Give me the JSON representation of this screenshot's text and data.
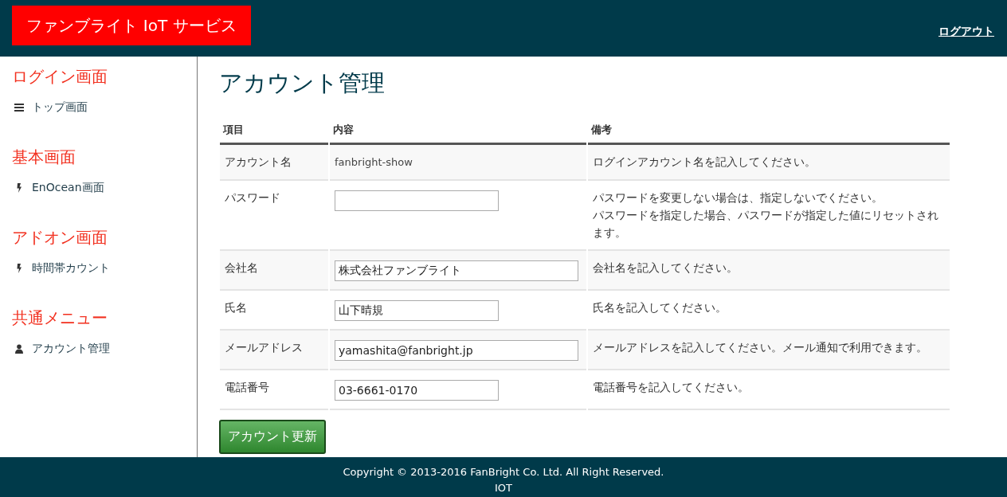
{
  "header": {
    "brand": "ファンブライト IoT サービス",
    "logout": "ログアウト"
  },
  "sidebar": [
    {
      "heading": "ログイン画面",
      "items": [
        {
          "label": "トップ画面",
          "kind": "list"
        }
      ]
    },
    {
      "heading": "基本画面",
      "items": [
        {
          "label": "EnOcean画面",
          "kind": "bolt"
        }
      ]
    },
    {
      "heading": "アドオン画面",
      "items": [
        {
          "label": "時間帯カウント",
          "kind": "bolt"
        }
      ]
    },
    {
      "heading": "共通メニュー",
      "items": [
        {
          "label": "アカウント管理",
          "kind": "user"
        }
      ]
    }
  ],
  "page_title": "アカウント管理",
  "table": {
    "columns": [
      "項目",
      "内容",
      "備考"
    ],
    "rows": [
      {
        "label": "アカウント名",
        "kind": "text",
        "value": "fanbright-show",
        "remarks": [
          "ログインアカウント名を記入してください。"
        ]
      },
      {
        "label": "パスワード",
        "kind": "short_field",
        "remarks": [
          "パスワードを変更しない場合は、指定しないでください。",
          "パスワードを指定した場合、パスワードが指定した値にリセットされます。"
        ]
      },
      {
        "label": "会社名",
        "kind": "long_field",
        "value": "株式会社ファンブライト",
        "remarks": [
          "会社名を記入してください。"
        ]
      },
      {
        "label": "氏名",
        "kind": "short_field",
        "value": "山下晴規",
        "remarks": [
          "氏名を記入してください。"
        ]
      },
      {
        "label": "メールアドレス",
        "kind": "long_field",
        "value": "yamashita@fanbright.jp",
        "remarks": [
          "メールアドレスを記入してください。メール通知で利用できます。"
        ]
      },
      {
        "label": "電話番号",
        "kind": "short_field",
        "value": "03-6661-0170",
        "remarks": [
          "電話番号を記入してください。"
        ]
      }
    ]
  },
  "submit_button": "アカウント更新",
  "footer": {
    "copyright": "Copyright © 2013-2016 FanBright Co. Ltd. All Right Reserved.",
    "product": "IOT"
  }
}
